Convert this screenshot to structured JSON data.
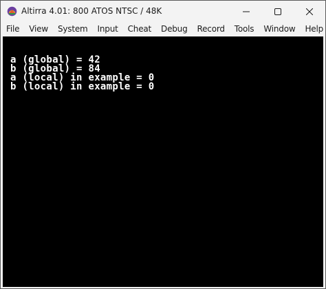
{
  "window": {
    "title": "Altirra 4.01: 800 ATOS NTSC / 48K",
    "app_icon": "altirra-app-icon",
    "controls": {
      "minimize_icon": "minimize-icon",
      "maximize_icon": "maximize-icon",
      "close_icon": "close-icon"
    }
  },
  "menubar": {
    "items": [
      {
        "label": "File"
      },
      {
        "label": "View"
      },
      {
        "label": "System"
      },
      {
        "label": "Input"
      },
      {
        "label": "Cheat"
      },
      {
        "label": "Debug"
      },
      {
        "label": "Record"
      },
      {
        "label": "Tools"
      },
      {
        "label": "Window"
      },
      {
        "label": "Help"
      }
    ]
  },
  "screen": {
    "background": "#000000",
    "text_color": "#ffffff",
    "lines": [
      "a (global) = 42",
      "b (global) = 84",
      "a (local) in example = 0",
      "b (local) in example = 0"
    ]
  }
}
